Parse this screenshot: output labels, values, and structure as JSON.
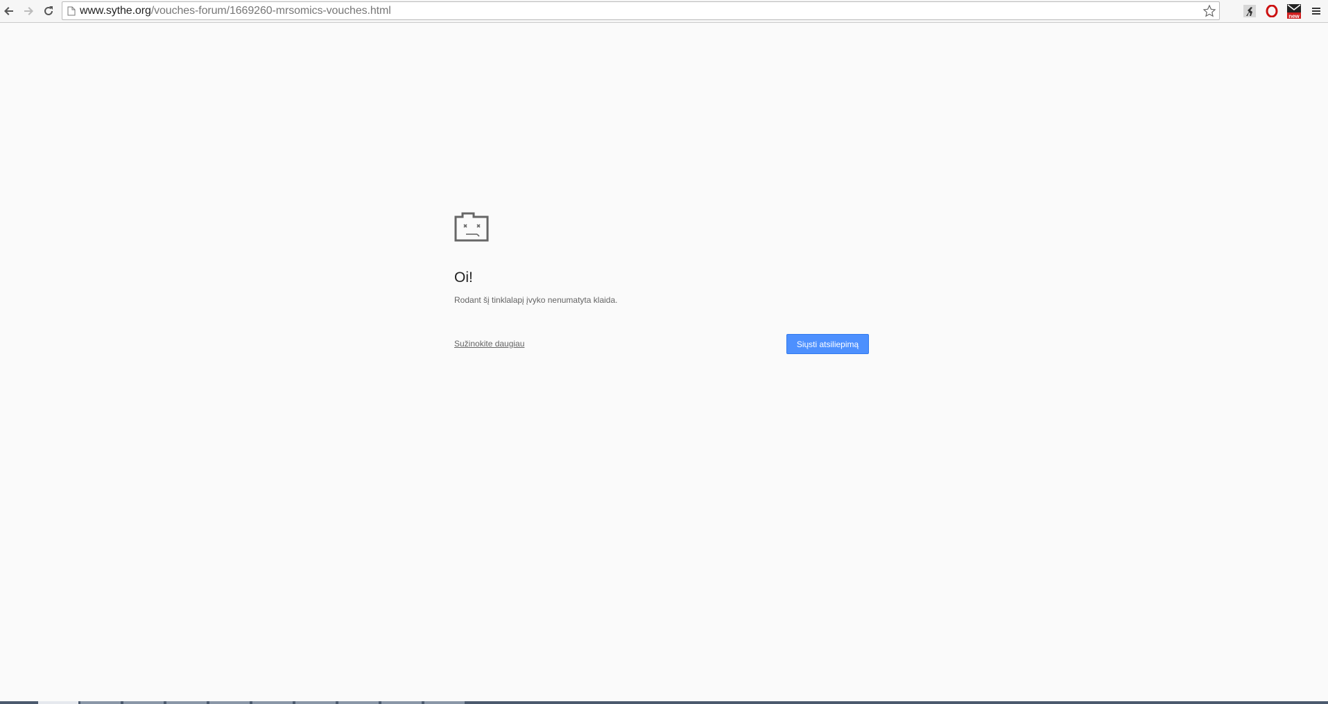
{
  "browser": {
    "url_host": "www.sythe.org",
    "url_path": "/vouches-forum/1669260-mrsomics-vouches.html",
    "back_icon": "back-arrow-icon",
    "forward_icon": "forward-arrow-icon",
    "reload_icon": "reload-icon",
    "bookmark_icon": "star-icon",
    "extensions": [
      {
        "icon": "runner-extension-icon"
      },
      {
        "icon": "opera-o-icon"
      },
      {
        "icon": "mail-new-icon",
        "badge": "new"
      }
    ],
    "menu_icon": "hamburger-menu-icon"
  },
  "error_page": {
    "icon": "sad-folder-icon",
    "title": "Oi!",
    "description": "Rodant šį tinklalapį įvyko nenumatyta klaida.",
    "learn_more": "Sužinokite daugiau",
    "feedback_button": "Siųsti atsiliepimą"
  },
  "colors": {
    "background": "#fafafa",
    "button": "#4d90fe",
    "text": "#646464"
  }
}
